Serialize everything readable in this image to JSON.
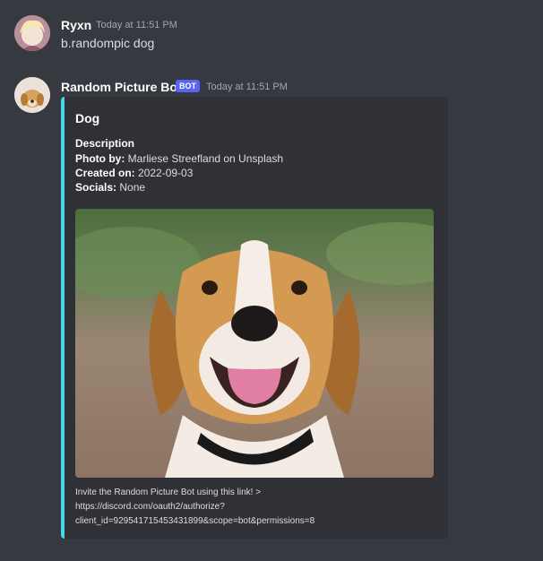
{
  "messages": [
    {
      "username": "Ryxn",
      "timestamp": "Today at 11:51 PM",
      "content": "b.randompic dog"
    },
    {
      "username": "Random Picture Bot",
      "bot_tag": "BOT",
      "timestamp": "Today at 11:51 PM",
      "embed": {
        "accent_color": "#47d7e4",
        "title": "Dog",
        "description_title": "Description",
        "fields": [
          {
            "label": "Photo by:",
            "value": " Marliese Streefland on Unsplash"
          },
          {
            "label": "Created on:",
            "value": " 2022-09-03"
          },
          {
            "label": "Socials:",
            "value": " None"
          }
        ],
        "image_alt": "beagle dog photo",
        "footer_lines": [
          "Invite the Random Picture Bot using this link! >",
          "https://discord.com/oauth2/authorize?",
          "client_id=929541715453431899&scope=bot&permissions=8"
        ]
      }
    }
  ]
}
